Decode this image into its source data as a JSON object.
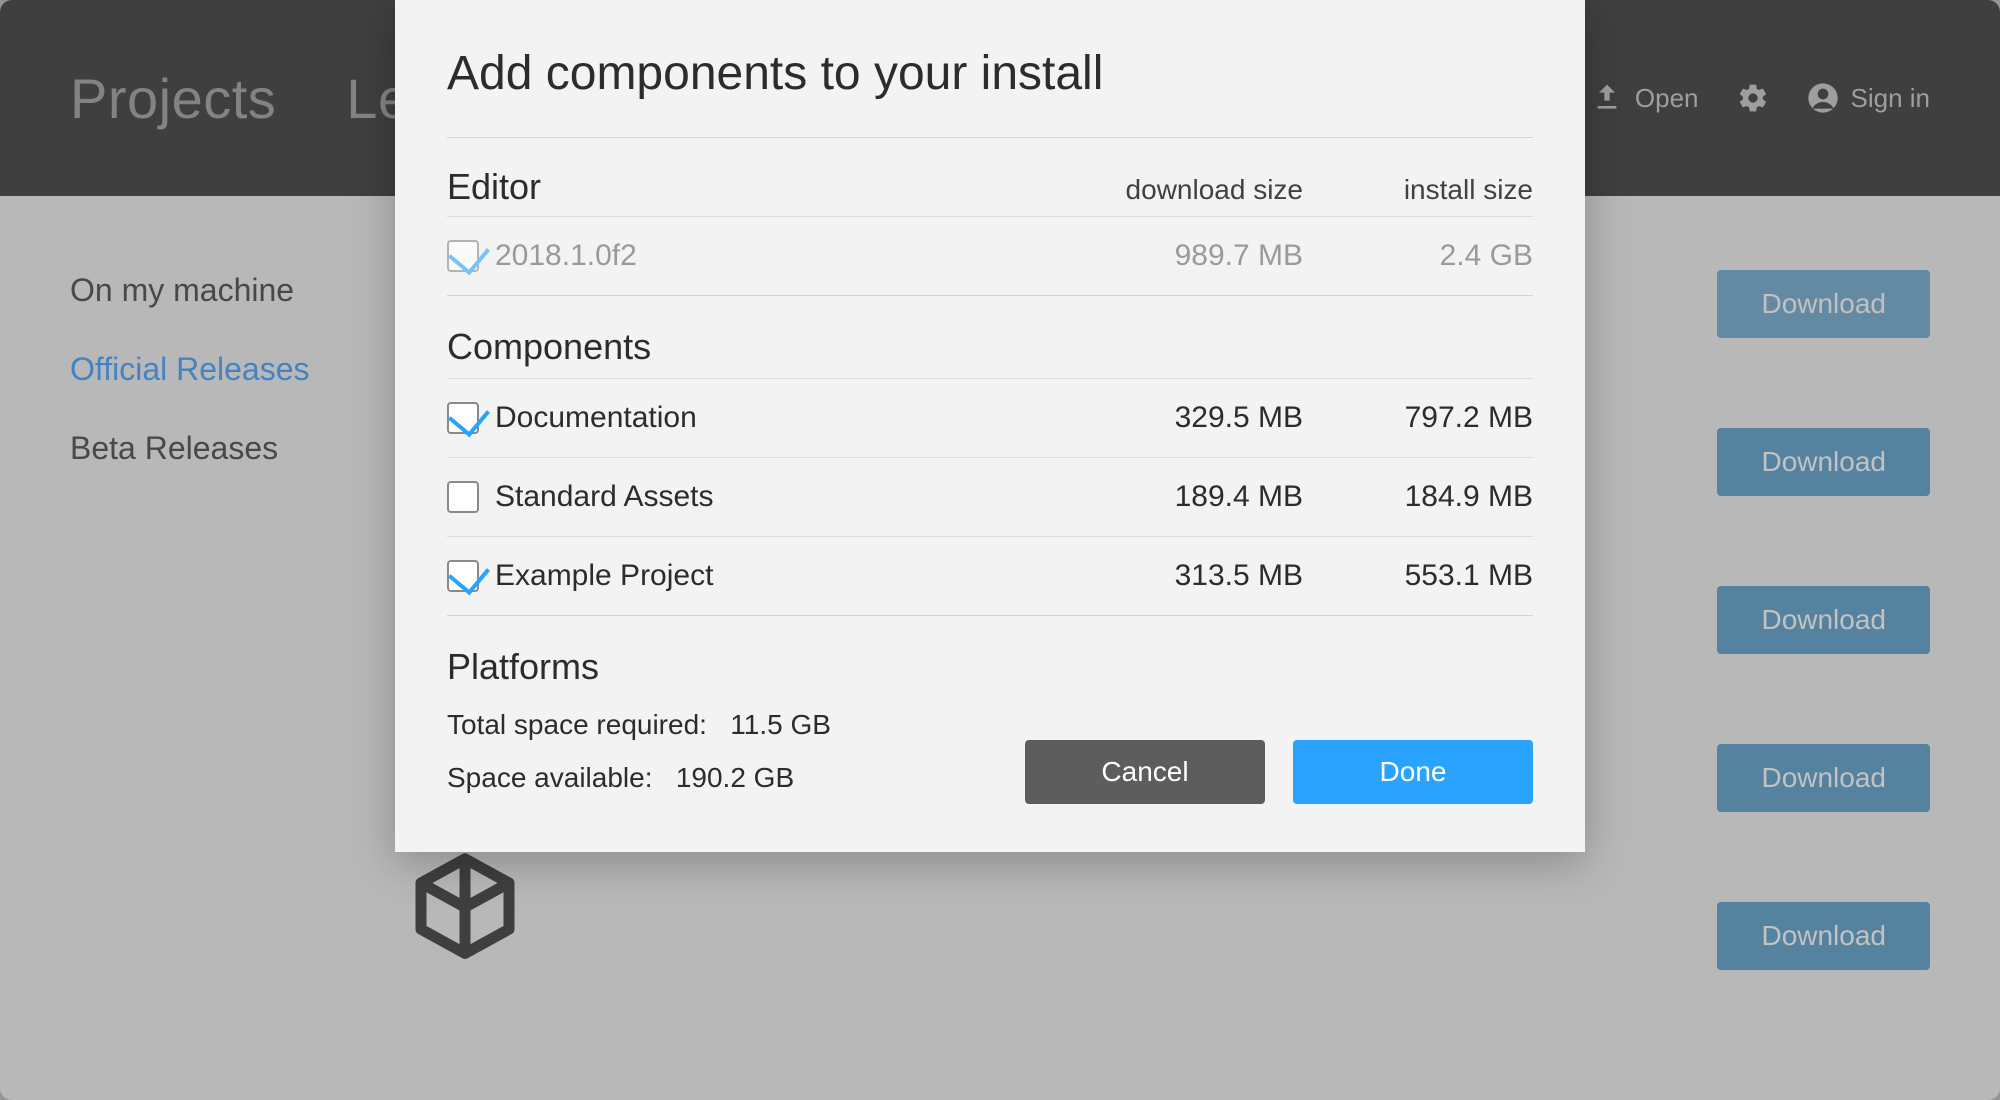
{
  "colors": {
    "accent": "#2aa3ff",
    "button_blue": "#3a8bc0"
  },
  "topnav": {
    "items": [
      "Projects",
      "Learn"
    ]
  },
  "topright": {
    "open": "Open",
    "signin": "Sign in"
  },
  "sidebar": {
    "items": [
      "On my machine",
      "Official Releases",
      "Beta Releases"
    ],
    "active_index": 1
  },
  "releases": {
    "download_label": "Download"
  },
  "dialog": {
    "title": "Add components to your install",
    "header": {
      "download_size": "download size",
      "install_size": "install size"
    },
    "editor_section_title": "Editor",
    "editor": {
      "name": "2018.1.0f2",
      "download_size": "989.7 MB",
      "install_size": "2.4 GB",
      "checked": true,
      "disabled": true
    },
    "components_section_title": "Components",
    "components": [
      {
        "name": "Documentation",
        "download_size": "329.5 MB",
        "install_size": "797.2 MB",
        "checked": true
      },
      {
        "name": "Standard Assets",
        "download_size": "189.4 MB",
        "install_size": "184.9 MB",
        "checked": false
      },
      {
        "name": "Example Project",
        "download_size": "313.5 MB",
        "install_size": "553.1 MB",
        "checked": true
      }
    ],
    "platforms_section_title": "Platforms",
    "footer": {
      "total_label": "Total space required:",
      "total_value": "11.5 GB",
      "available_label": "Space available:",
      "available_value": "190.2 GB"
    },
    "buttons": {
      "cancel": "Cancel",
      "done": "Done"
    }
  }
}
